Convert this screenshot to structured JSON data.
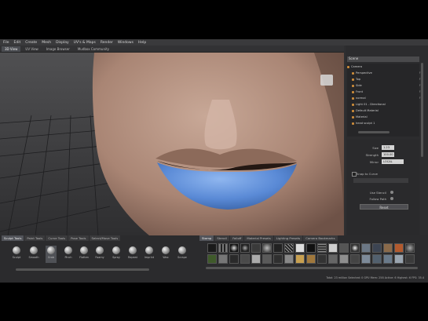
{
  "menu": [
    "File",
    "Edit",
    "Create",
    "Mesh",
    "Display",
    "UV's & Maps",
    "Render",
    "Windows",
    "Help"
  ],
  "viewport_tabs": [
    {
      "label": "3D View",
      "active": true
    },
    {
      "label": "UV View",
      "active": false
    },
    {
      "label": "Image Browser",
      "active": false
    },
    {
      "label": "Mudbox Community",
      "active": false
    }
  ],
  "right_panel": {
    "dropdown": "Scene",
    "tree": [
      {
        "label": "Camera",
        "key": ""
      },
      {
        "label": "Perspective",
        "key": "F1"
      },
      {
        "label": "Top",
        "key": "F2"
      },
      {
        "label": "Side",
        "key": "F3"
      },
      {
        "label": "Front",
        "key": "F4"
      },
      {
        "label": "normal",
        "key": "F5"
      },
      {
        "label": "Light 01 - Directional",
        "key": ""
      },
      {
        "label": "Default Material",
        "key": ""
      },
      {
        "label": "Material",
        "key": ""
      },
      {
        "label": "head sculpt 1",
        "key": ""
      }
    ],
    "props": {
      "size_label": "Size",
      "size_value": "1.23",
      "strength_label": "Strength",
      "strength_value": "100.00",
      "mirror_label": "Mirror",
      "mirror_value": "LOCAL",
      "snap_label": "Snap to Curve",
      "use_stencil_label": "Use Stencil",
      "follow_path_label": "Follow Path",
      "reset_label": "Reset"
    }
  },
  "bottom_tabs_left": [
    {
      "label": "Sculpt Tools",
      "active": true
    },
    {
      "label": "Paint Tools",
      "active": false
    },
    {
      "label": "Curve Tools",
      "active": false
    },
    {
      "label": "Pose Tools",
      "active": false
    },
    {
      "label": "Select/Move Tools",
      "active": false
    }
  ],
  "tools": [
    {
      "label": "Sculpt",
      "selected": false
    },
    {
      "label": "Smooth",
      "selected": false
    },
    {
      "label": "Grab",
      "selected": true
    },
    {
      "label": "Pinch",
      "selected": false
    },
    {
      "label": "Flatten",
      "selected": false
    },
    {
      "label": "Foamy",
      "selected": false
    },
    {
      "label": "Spray",
      "selected": false
    },
    {
      "label": "Repeat",
      "selected": false
    },
    {
      "label": "Imprint",
      "selected": false
    },
    {
      "label": "Wax",
      "selected": false
    },
    {
      "label": "Scrape",
      "selected": false
    }
  ],
  "bottom_tabs_right": [
    {
      "label": "Stamp",
      "active": true
    },
    {
      "label": "Stencil",
      "active": false
    },
    {
      "label": "Falloff",
      "active": false
    },
    {
      "label": "Material Presets",
      "active": false
    },
    {
      "label": "Lighting Presets",
      "active": false
    },
    {
      "label": "Camera Bookmarks",
      "active": false
    }
  ],
  "status": "Total: 23 million  Selected: 0  GPU Mem: 258  Active: 6  Highest: 6  FPS: 35.4"
}
